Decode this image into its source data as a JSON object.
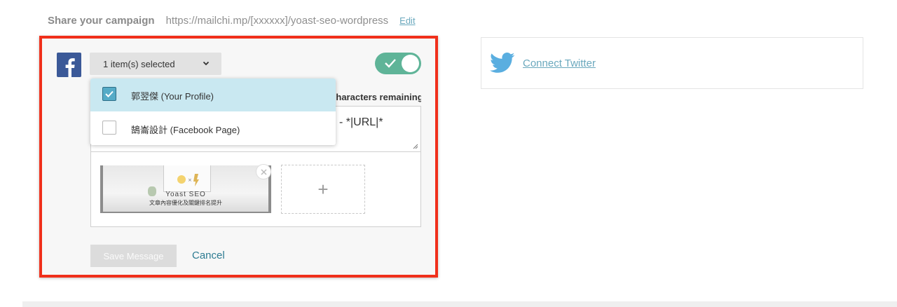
{
  "share": {
    "label": "Share your campaign",
    "url": "https://mailchi.mp/[xxxxxx]/yoast-seo-wordpress",
    "edit": "Edit"
  },
  "facebook": {
    "account_select_label": "1 item(s) selected",
    "toggle_on": true,
    "chars_remaining": "Characters remaining",
    "message_text": "- *|URL|*",
    "accounts": [
      {
        "label": "郭翌傑 (Your Profile)",
        "checked": true
      },
      {
        "label": "鵠崙設計 (Facebook Page)",
        "checked": false
      }
    ],
    "image": {
      "title": "Yoast SEO",
      "subtitle": "文章內容優化及關鍵排名提升"
    },
    "add_image_symbol": "+",
    "save_label": "Save Message",
    "cancel_label": "Cancel"
  },
  "twitter": {
    "connect_label": "Connect Twitter"
  },
  "colors": {
    "highlight_border": "#f0301b",
    "facebook_blue": "#3b5998",
    "toggle_green": "#5fb498",
    "selected_row": "#c9e8f1",
    "checkbox_checked": "#55abc7",
    "link_blue": "#6aa8bd",
    "twitter_blue": "#5aaee0"
  },
  "icons": [
    "facebook-icon",
    "chevron-down-icon",
    "checkmark-icon",
    "close-icon",
    "plus-icon",
    "twitter-icon",
    "resize-handle-icon"
  ]
}
